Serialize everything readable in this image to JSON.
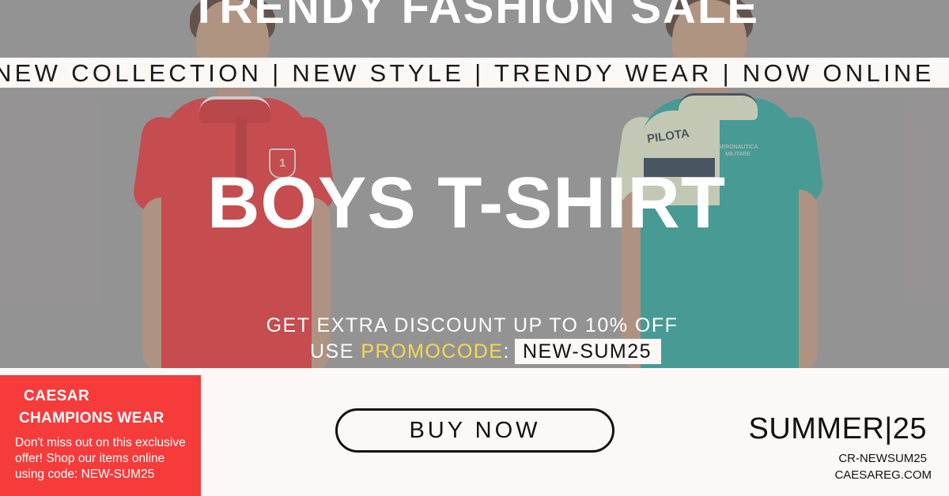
{
  "hero": {
    "title": "TRENDY FASHION SALE",
    "ticker": "NEW COLLECTION | NEW STYLE | TRENDY WEAR | NOW ONLINE",
    "headline": "BOYS T-SHIRT",
    "discount": "GET EXTRA DISCOUNT UP TO 10% OFF",
    "promo_prefix": "USE ",
    "promo_highlight": "PROMOCODE",
    "promo_colon": ":",
    "promo_code": "NEW-SUM25",
    "shirt_left_print": "1",
    "shirt_right_print_1": "PILOTA",
    "shirt_right_print_2": "AERONAUTICA MILITARE"
  },
  "brand": {
    "line1": "CAESAR",
    "line2": "CHAMPIONS WEAR",
    "offer": "Don't miss out on this exclusive offer! Shop our items online using code: NEW-SUM25"
  },
  "cta": {
    "label": "BUY NOW"
  },
  "footer": {
    "season": "SUMMER|25",
    "code": "CR-NEWSUM25",
    "site": "CAESAREG.COM"
  },
  "colors": {
    "accent_red": "#f63b3b",
    "promo_yellow": "#f7d84e",
    "background": "#fcf8f6",
    "shirt_red": "#e8262b",
    "shirt_teal": "#1fa39c"
  }
}
